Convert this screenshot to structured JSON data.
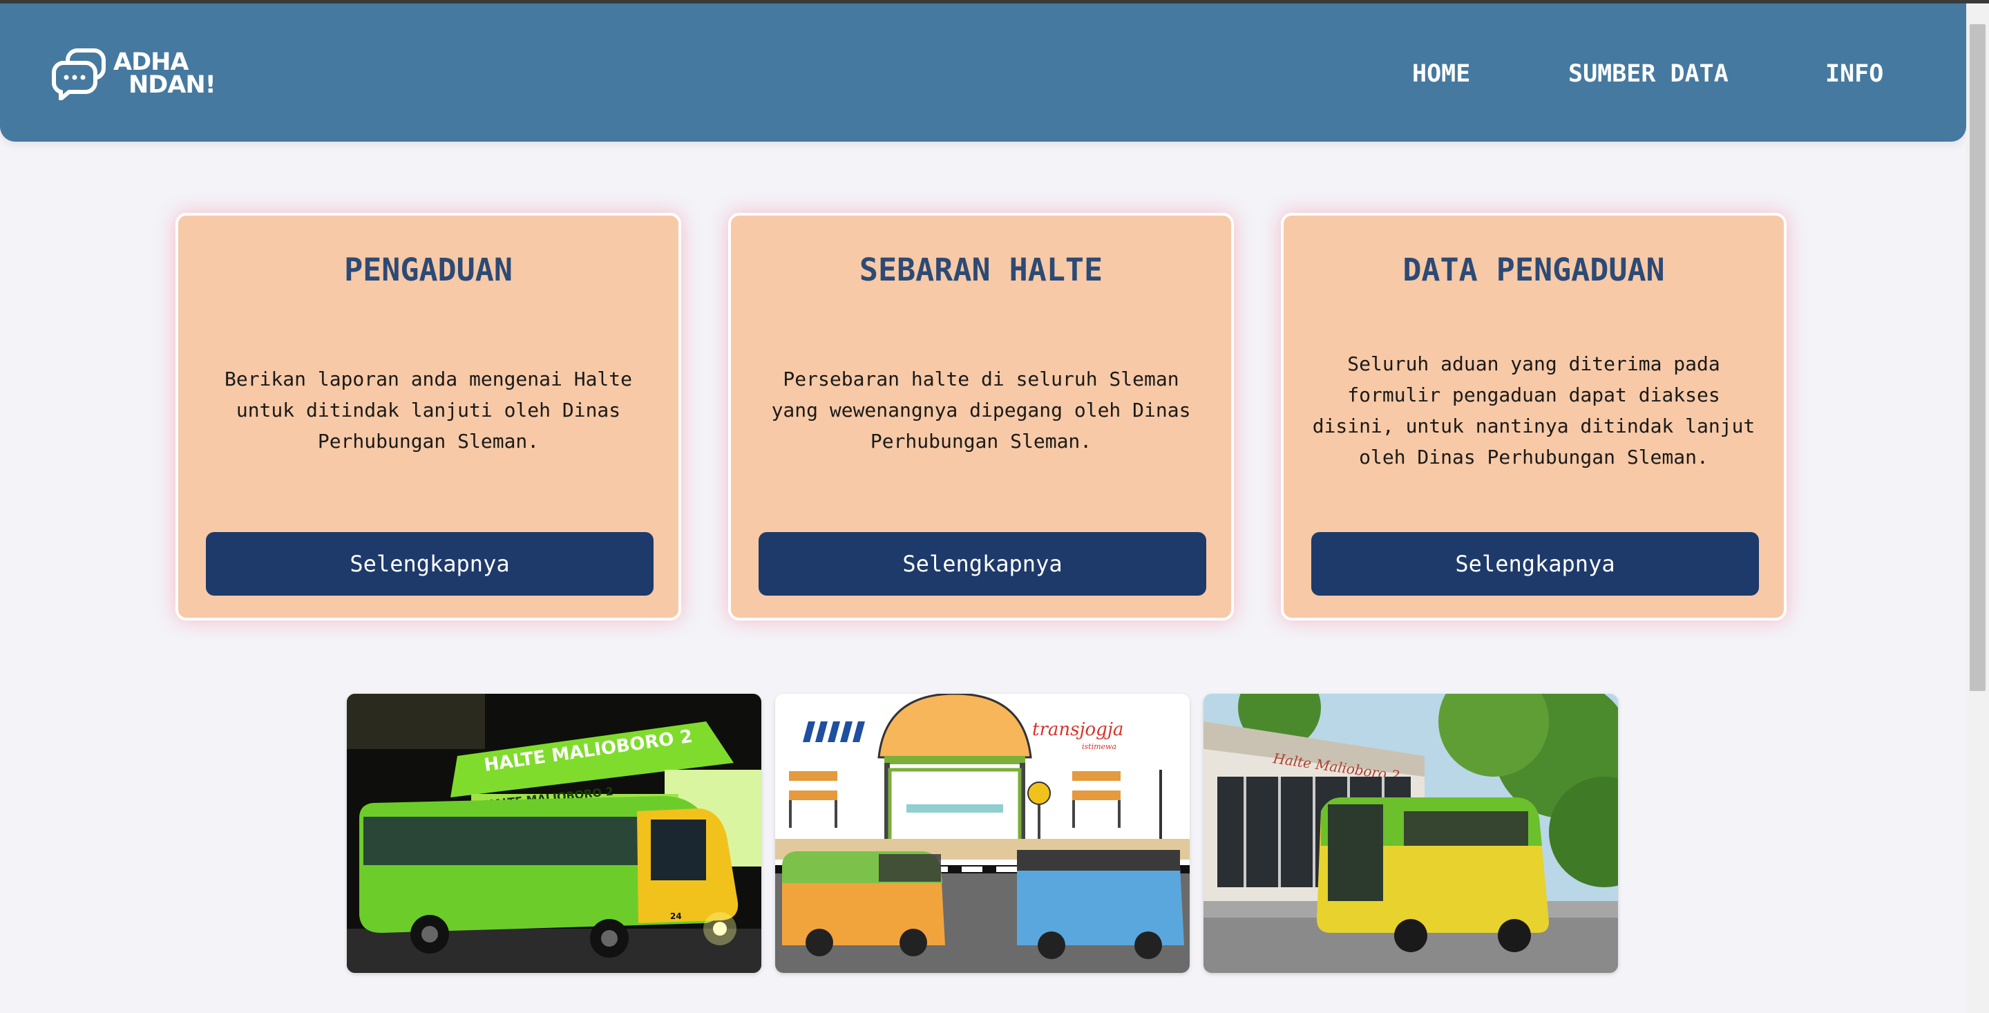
{
  "brand": {
    "line1": "ADHA",
    "line2": "NDAN!",
    "icon": "chat-bubbles-icon"
  },
  "nav": {
    "home": "HOME",
    "sumber_data": "SUMBER DATA",
    "info": "INFO"
  },
  "cards": [
    {
      "title": "PENGADUAN",
      "text": "Berikan laporan anda mengenai Halte untuk ditindak lanjuti oleh Dinas Perhubungan Sleman.",
      "button": "Selengkapnya"
    },
    {
      "title": "SEBARAN HALTE",
      "text": "Persebaran halte di seluruh Sleman yang wewenangnya dipegang oleh Dinas Perhubungan Sleman.",
      "button": "Selengkapnya"
    },
    {
      "title": "DATA PENGADUAN",
      "text": "Seluruh aduan yang diterima pada formulir pengaduan dapat diakses disini, untuk nantinya ditindak lanjut oleh Dinas Perhubungan Sleman.",
      "button": "Selengkapnya"
    }
  ],
  "gallery": {
    "photo1": {
      "sign": "HALTE MALIOBORO 2",
      "sign2": "HALTE MALIOBORO 2",
      "badge": "24"
    },
    "photo2": {
      "brand": "transjogja",
      "tagline": "istimewa"
    },
    "photo3": {
      "sign": "Halte Malioboro 2"
    }
  },
  "colors": {
    "navbar": "#4679a0",
    "card": "#f7c9a6",
    "card_title": "#2c4a75",
    "button": "#1e3a6b",
    "background": "#f3f3f8"
  }
}
